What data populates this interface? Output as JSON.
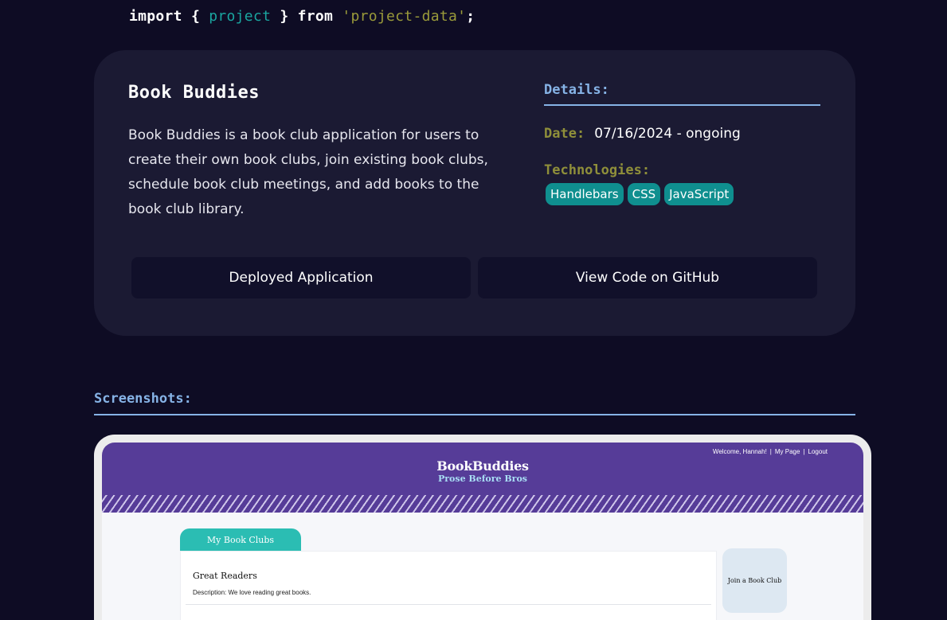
{
  "code_header": {
    "keyword_import": "import",
    "open_brace": "{",
    "identifier": "project",
    "close_brace": "}",
    "keyword_from": "from",
    "module": "'project-data'",
    "semicolon": ";"
  },
  "project": {
    "title": "Book Buddies",
    "description": "Book Buddies is a book club application for users to create their own book clubs, join existing book clubs, schedule book club meetings, and add books to the book club library.",
    "details_heading": "Details:",
    "date_label": "Date:",
    "date_value": "07/16/2024 - ongoing",
    "technologies_label": "Technologies:",
    "technologies": [
      "Handlebars",
      "CSS",
      "JavaScript"
    ],
    "deploy_button": "Deployed Application",
    "github_button": "View Code on GitHub"
  },
  "screenshots": {
    "heading": "Screenshots:",
    "app": {
      "nav_welcome": "Welcome, Hannah!",
      "nav_sep": "|",
      "nav_my_page": "My Page",
      "nav_logout": "Logout",
      "brand": "BookBuddies",
      "tagline": "Prose Before Bros",
      "tab_label": "My Book Clubs",
      "club_name": "Great Readers",
      "club_description": "Description: We love reading great books.",
      "join_button": "Join a Book Club"
    }
  },
  "colors": {
    "page_background": "#0e0c24",
    "card_background": "#1b1a33",
    "accent_blue": "#86b3e6",
    "accent_olive": "#8f8f3a",
    "tag_teal": "#0f8f8f",
    "app_purple": "#563c98",
    "app_teal": "#2bbdb3"
  }
}
